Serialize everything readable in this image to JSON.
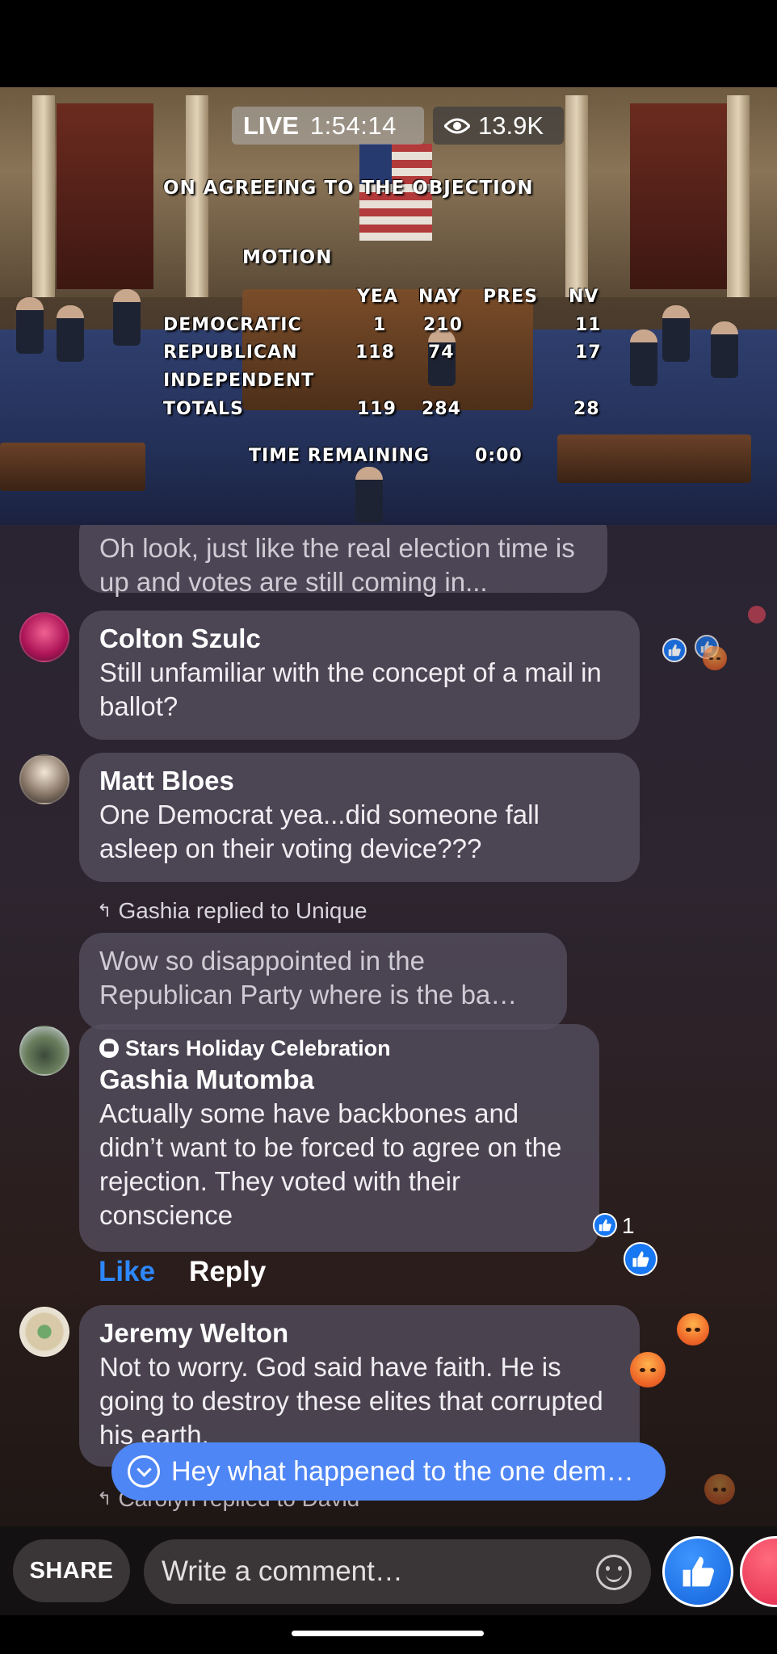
{
  "video": {
    "live_label": "LIVE",
    "duration": "1:54:14",
    "viewers": "13.9K",
    "tally": {
      "heading": "ON AGREEING TO THE OBJECTION",
      "motion": "MOTION",
      "columns": [
        "YEA",
        "NAY",
        "PRES",
        "NV"
      ],
      "rows": [
        {
          "party": "DEMOCRATIC",
          "yea": "1",
          "nay": "210",
          "pres": "",
          "nv": "11"
        },
        {
          "party": "REPUBLICAN",
          "yea": "118",
          "nay": "74",
          "pres": "",
          "nv": "17"
        },
        {
          "party": "INDEPENDENT",
          "yea": "",
          "nay": "",
          "pres": "",
          "nv": ""
        },
        {
          "party": "TOTALS",
          "yea": "119",
          "nay": "284",
          "pres": "",
          "nv": "28"
        }
      ],
      "time_label": "TIME REMAINING",
      "time_value": "0:00"
    }
  },
  "comments": [
    {
      "text": "Oh look, just like the real election time is up and votes are still coming in..."
    },
    {
      "name": "Colton Szulc",
      "text": "Still unfamiliar with the concept of a mail in ballot?"
    },
    {
      "name": "Matt Bloes",
      "text": "One Democrat yea...did someone fall asleep on their voting device???"
    },
    {
      "reply_header": "Gashia replied to Unique",
      "text": "Wow so disappointed in the Republican Party where is the ba…"
    },
    {
      "group": "Stars Holiday Celebration",
      "name": "Gashia Mutomba",
      "text": "Actually some have backbones and didn’t want to be forced to agree on the rejection. They voted with their conscience",
      "reaction_count": "1",
      "like_label": "Like",
      "reply_label": "Reply"
    },
    {
      "name": "Jeremy Welton",
      "text": "Not to worry.  God said have faith.  He is going to destroy these elites that corrupted his earth."
    },
    {
      "reply_header": "Carolyn replied to David"
    }
  ],
  "new_comment_pill": "Hey what happened to the one dem…",
  "bottom_bar": {
    "share_label": "SHARE",
    "comment_placeholder": "Write a comment…"
  },
  "colors": {
    "like_blue": "#1877f2",
    "pill_blue": "#4f86f5",
    "link_blue": "#2d88ff"
  }
}
